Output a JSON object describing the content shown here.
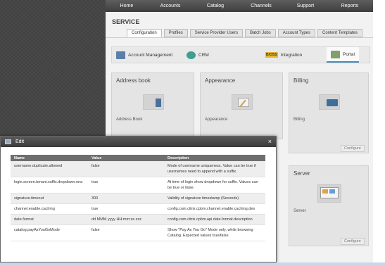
{
  "topnav": {
    "items": [
      "Home",
      "Accounts",
      "Catalog",
      "Channels",
      "Support",
      "Reports"
    ]
  },
  "service": {
    "title": "SERVICE",
    "tabs": [
      "Configuration",
      "Profiles",
      "Service Provider Users",
      "Batch Jobs",
      "Account Types",
      "Content Templates"
    ]
  },
  "modules": {
    "account_management": "Account Management",
    "crm": "CRM",
    "integration": "Integration",
    "integration_badge": "B/OSS",
    "portal": "Portal"
  },
  "cards": {
    "address_book": {
      "title": "Address book",
      "label": "Address Book"
    },
    "appearance": {
      "title": "Appearance",
      "label": "Appearance"
    },
    "billing": {
      "title": "Billing",
      "label": "Billing",
      "button": "Configure"
    },
    "server": {
      "title": "Server",
      "label": "Server",
      "button": "Configure"
    }
  },
  "modal": {
    "title": "Edit",
    "close": "×",
    "headers": {
      "name": "Name",
      "value": "Value",
      "description": "Description"
    },
    "rows": [
      {
        "name": "username.duplicate.allowed",
        "value": "false",
        "description": "Mode of username uniqueness. Value can be true if usernames need to append with a suffix."
      },
      {
        "name": "login.screen.tenant.suffix.dropdown.ena",
        "value": "true",
        "description": "At time of login show dropdown for suffix. Values can be true or false."
      },
      {
        "name": "signature.timeout",
        "value": "300",
        "description": "Validity of signature timestamp (Seconds)"
      },
      {
        "name": "channel.enable.caching",
        "value": "true",
        "description": "config.com.citrix.cpbm.channel.enable.caching.des"
      },
      {
        "name": "date.format",
        "value": "dd MMM yyyy HH:mm:ss zzz",
        "description": "config.com.citrix.cpbm.api.date.format.description"
      },
      {
        "name": "catalog.payAsYouGoMode",
        "value": "false",
        "description": "Show \"Pay As You Go\" Mode only, while browsing Catalog. Expected values true/false."
      }
    ]
  },
  "colors": {
    "nav_bg": "#4a4a4a",
    "accent": "#4a8ab5",
    "table_header": "#6e6e6e"
  }
}
